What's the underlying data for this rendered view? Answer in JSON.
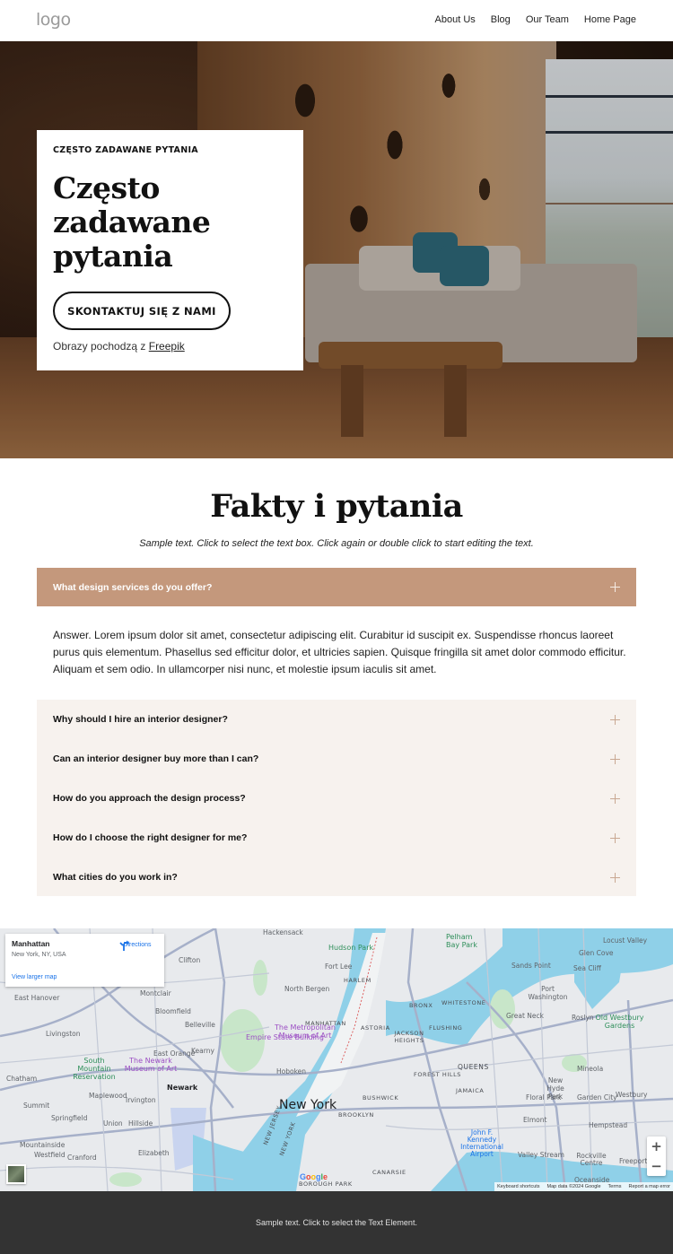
{
  "header": {
    "logo": "logo",
    "nav": [
      "About Us",
      "Blog",
      "Our Team",
      "Home Page"
    ]
  },
  "hero": {
    "eyebrow": "CZĘSTO ZADAWANE PYTANIA",
    "title": "Często zadawane pytania",
    "cta_label": "SKONTAKTUJ SIĘ Z NAMI",
    "credit_prefix": "Obrazy pochodzą z ",
    "credit_link": "Freepik"
  },
  "faq": {
    "title": "Fakty i pytania",
    "subtitle": "Sample text. Click to select the text box. Click again or double click to start editing the text.",
    "accent_color": "#c4987c",
    "list_bg_color": "#f7f2ee",
    "active": {
      "question": "What design services do you offer?",
      "answer": "Answer. Lorem ipsum dolor sit amet, consectetur adipiscing elit. Curabitur id suscipit ex. Suspendisse rhoncus laoreet purus quis elementum. Phasellus sed efficitur dolor, et ultricies sapien. Quisque fringilla sit amet dolor commodo efficitur. Aliquam et sem odio. In ullamcorper nisi nunc, et molestie ipsum iaculis sit amet."
    },
    "items": [
      {
        "question": "Why should I hire an interior designer?"
      },
      {
        "question": "Can an interior designer buy more than I can?"
      },
      {
        "question": "How do you approach the design process?"
      },
      {
        "question": "How do I choose the right designer for me?"
      },
      {
        "question": "What cities do you work in?"
      }
    ]
  },
  "map": {
    "place_name": "Manhattan",
    "place_address": "New York, NY, USA",
    "view_larger": "View larger map",
    "directions": "Directions",
    "zoom_in": "+",
    "zoom_out": "−",
    "google": "Google",
    "attribution": [
      "Keyboard shortcuts",
      "Map data ©2024 Google",
      "Terms",
      "Report a map error"
    ],
    "labels": {
      "new_york": "New York",
      "manhattan": "MANHATTAN",
      "harlem": "HARLEM",
      "astoria": "ASTORIA",
      "jackson_heights": "JACKSON HEIGHTS",
      "flushing": "FLUSHING",
      "queens": "QUEENS",
      "forest_hills": "FOREST HILLS",
      "jamaica": "JAMAICA",
      "bushwick": "BUSHWICK",
      "brooklyn": "BROOKLYN",
      "canarsie": "CANARSIE",
      "borough_park": "BOROUGH PARK",
      "whitestone": "WHITESTONE",
      "bronx": "BRONX",
      "hoboken": "Hoboken",
      "north_bergen": "North Bergen",
      "fort_lee": "Fort Lee",
      "hackensack": "Hackensack",
      "hudson_park": "Hudson Park",
      "clifton": "Clifton",
      "montclair": "Montclair",
      "bloomfield": "Bloomfield",
      "belleville": "Belleville",
      "east_orange": "East Orange",
      "kearny": "Kearny",
      "newark": "Newark",
      "irvington": "Irvington",
      "maplewood": "Maplewood",
      "livingston": "Livingston",
      "east_hanover": "East Hanover",
      "chatham": "Chatham",
      "summit": "Summit",
      "springfield": "Springfield",
      "union": "Union",
      "hillside": "Hillside",
      "mountainside": "Mountainside",
      "westfield": "Westfield",
      "cranford": "Cranford",
      "elizabeth": "Elizabeth",
      "south_mountain": "South Mountain Reservation",
      "newark_museum": "The Newark Museum of Art",
      "met_museum": "The Metropolitan Museum of Art",
      "empire_state": "Empire State Building",
      "pelham_bay": "Pelham Bay Park",
      "sands_point": "Sands Point",
      "port_washington": "Port Washington",
      "great_neck": "Great Neck",
      "roslyn": "Roslyn",
      "glen_cove": "Glen Cove",
      "sea_cliff": "Sea Cliff",
      "locust_valley": "Locust Valley",
      "old_westbury": "Old Westbury Gardens",
      "westbury": "Westbury",
      "mineola": "Mineola",
      "new_hyde_park": "New Hyde Park",
      "floral_park": "Floral Park",
      "garden_city": "Garden City",
      "hempstead": "Hempstead",
      "elmont": "Elmont",
      "valley_stream": "Valley Stream",
      "rockville_centre": "Rockville Centre",
      "freeport": "Freeport",
      "oceanside": "Oceanside",
      "jfk": "John F. Kennedy International Airport",
      "new_jersey": "NEW JERSEY",
      "new_york_state": "NEW YORK"
    }
  },
  "footer": {
    "text": "Sample text. Click to select the Text Element."
  }
}
